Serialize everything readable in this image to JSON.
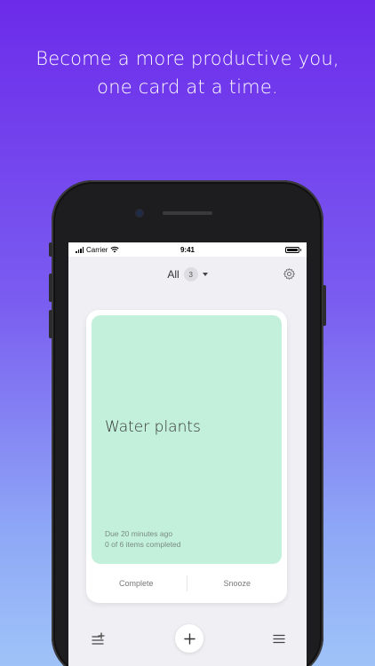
{
  "headline": {
    "line1": "Become a more productive you,",
    "line2": "one card at a time."
  },
  "status_bar": {
    "carrier": "Carrier",
    "time": "9:41",
    "signal_icon": "signal-bars-icon",
    "wifi_icon": "wifi-icon",
    "battery_icon": "battery-icon"
  },
  "nav": {
    "filter_label": "All",
    "filter_count": "3",
    "settings_icon": "gear-icon"
  },
  "card": {
    "title": "Water plants",
    "due": "Due 20 minutes ago",
    "progress": "0 of 6 items completed",
    "color": "#c3f0db",
    "complete_label": "Complete",
    "snooze_label": "Snooze"
  },
  "toolbar": {
    "left_icon": "add-list-icon",
    "center_icon": "plus-icon",
    "right_icon": "menu-icon"
  },
  "colors": {
    "gradient_top": "#6c2bea",
    "gradient_bottom": "#9fc3f8"
  }
}
